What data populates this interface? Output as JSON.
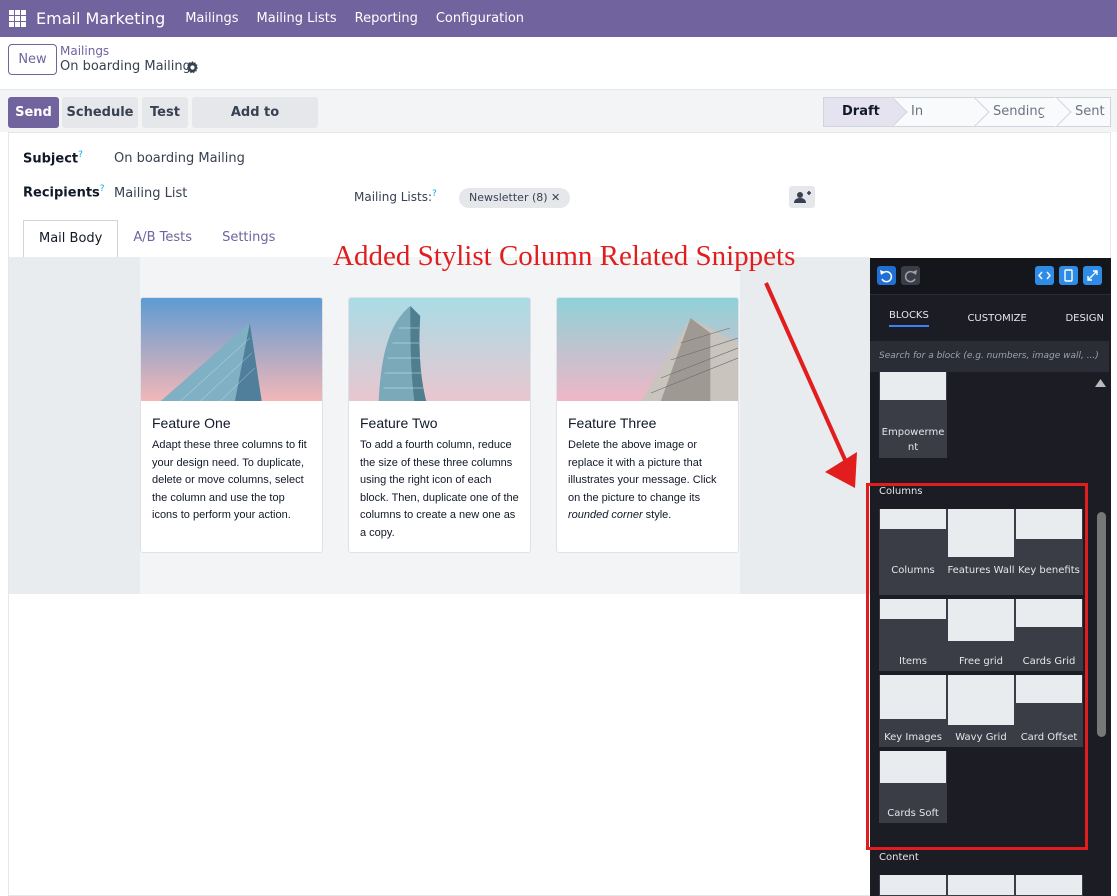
{
  "navbar": {
    "app_name": "Email Marketing",
    "items": [
      "Mailings",
      "Mailing Lists",
      "Reporting",
      "Configuration"
    ],
    "color": "#71639e"
  },
  "control_panel": {
    "new_label": "New",
    "breadcrumb_parent": "Mailings",
    "breadcrumb_current": "On boarding Mailing"
  },
  "actions": {
    "send": "Send",
    "schedule": "Schedule",
    "test": "Test",
    "add_to_templates": "Add to Templates"
  },
  "statusbar": {
    "stages": [
      "Draft",
      "In Queue",
      "Sending",
      "Sent"
    ],
    "active": "Draft"
  },
  "form": {
    "subject_label": "Subject",
    "subject_value": "On boarding Mailing",
    "recipients_label": "Recipients",
    "recipients_value": "Mailing List",
    "mailing_lists_label": "Mailing Lists:",
    "mailing_list_tag": "Newsletter (8)",
    "help_mark": "?",
    "tag_remove": "✕"
  },
  "tabs": [
    "Mail Body",
    "A/B Tests",
    "Settings"
  ],
  "cards": [
    {
      "title": "Feature One",
      "text": "Adapt these three columns to fit your design need. To duplicate, delete or move columns, select the column and use the top icons to perform your action."
    },
    {
      "title": "Feature Two",
      "text": "To add a fourth column, reduce the size of these three columns using the right icon of each block. Then, duplicate one of the columns to create a new one as a copy."
    },
    {
      "title": "Feature Three",
      "text_before": "Delete the above image or replace it with a picture that illustrates your message. Click on the picture to change its ",
      "text_em": "rounded corner",
      "text_after": " style."
    }
  ],
  "annotation": "Added Stylist Column Related Snippets",
  "sidebar": {
    "tabs": [
      "BLOCKS",
      "CUSTOMIZE",
      "DESIGN"
    ],
    "search_placeholder": "Search for a block (e.g. numbers, image wall, ...)",
    "top_snippet": "Empowerme nt",
    "columns_label": "Columns",
    "column_snippets": [
      "Columns",
      "Features Wall",
      "Key benefits",
      "Items",
      "Free grid",
      "Cards Grid",
      "Key Images",
      "Wavy Grid",
      "Card Offset",
      "Cards Soft"
    ],
    "content_label": "Content"
  },
  "colors": {
    "accent": "#71639e",
    "annotation_red": "#e11d1d",
    "sidebar_bg": "#1b1c24",
    "sidebar_accent": "#3b82f6"
  }
}
